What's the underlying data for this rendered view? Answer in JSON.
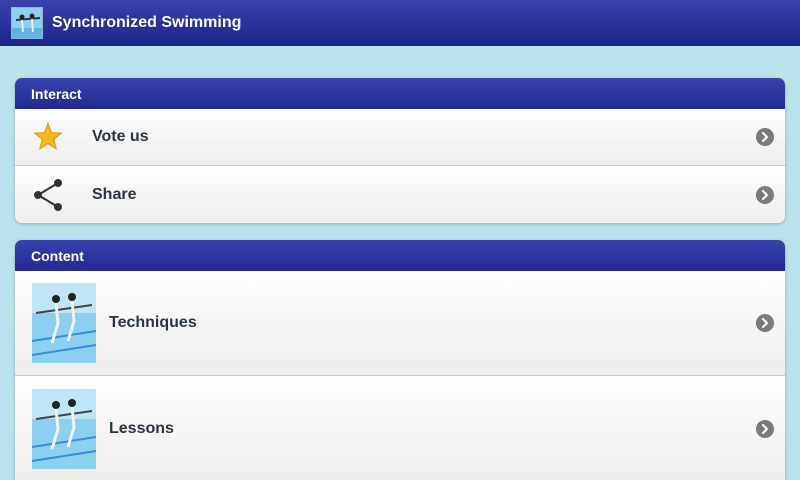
{
  "app": {
    "title": "Synchronized Swimming",
    "icon": "swimmers-app-icon"
  },
  "sections": [
    {
      "title": "Interact",
      "items": [
        {
          "label": "Vote us",
          "icon": "star-icon"
        },
        {
          "label": "Share",
          "icon": "share-icon"
        }
      ]
    },
    {
      "title": "Content",
      "items": [
        {
          "label": "Techniques",
          "icon": "swimmers-thumbnail"
        },
        {
          "label": "Lessons",
          "icon": "swimmers-thumbnail"
        }
      ]
    }
  ],
  "colors": {
    "header": "#2a3196",
    "background": "#b9e3ea",
    "star": "#f6b91c"
  }
}
